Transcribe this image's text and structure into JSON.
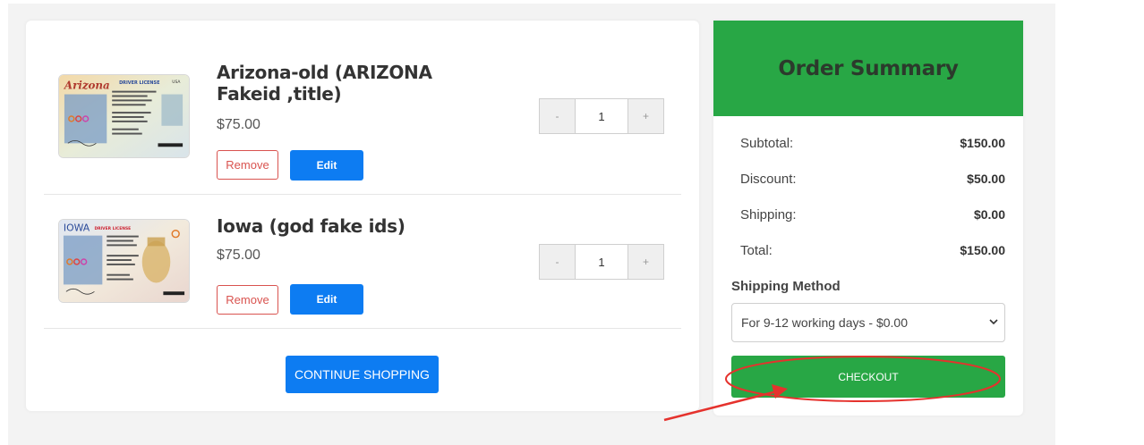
{
  "cart": {
    "items": [
      {
        "title": "Arizona-old (ARIZONA Fakeid ,title)",
        "price": "$75.00",
        "quantity": "1",
        "remove_label": "Remove",
        "edit_label": "Edit",
        "minus_label": "-",
        "plus_label": "+",
        "card_state": "Arizona",
        "card_type": "DRIVER LICENSE",
        "card_country": "USA"
      },
      {
        "title": "Iowa (god fake ids)",
        "price": "$75.00",
        "quantity": "1",
        "remove_label": "Remove",
        "edit_label": "Edit",
        "minus_label": "-",
        "plus_label": "+",
        "card_state": "IOWA",
        "card_type": "DRIVER LICENSE"
      }
    ],
    "continue_label": "CONTINUE SHOPPING"
  },
  "summary": {
    "title": "Order Summary",
    "rows": [
      {
        "label": "Subtotal:",
        "value": "$150.00"
      },
      {
        "label": "Discount:",
        "value": "$50.00"
      },
      {
        "label": "Shipping:",
        "value": "$0.00"
      },
      {
        "label": "Total:",
        "value": "$150.00"
      }
    ],
    "shipping_method_label": "Shipping Method",
    "shipping_method_selected": "For 9-12 working days - $0.00",
    "checkout_label": "CHECKOUT"
  },
  "colors": {
    "accent_green": "#28a745",
    "accent_blue": "#0d7cf2",
    "remove_red": "#d9534f",
    "annotation_red": "#e5322d"
  }
}
